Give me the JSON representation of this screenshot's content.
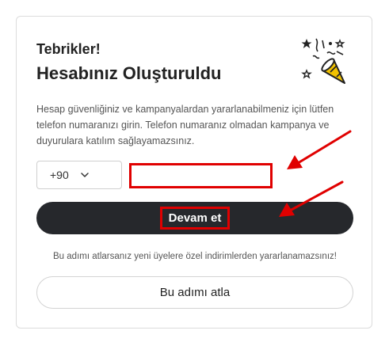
{
  "card": {
    "congrats": "Tebrikler!",
    "title": "Hesabınız Oluşturuldu",
    "description": "Hesap güvenliğiniz ve kampanyalardan yararlanabilmeniz için lütfen telefon numaranızı girin. Telefon numaranız olmadan kampanya ve duyurulara katılım sağlayamazsınız.",
    "country_code": "+90",
    "phone_value": "",
    "continue_label": "Devam et",
    "warning": "Bu adımı atlarsanız yeni üyelere özel indirimlerden yararlanamazsınız!",
    "skip_label": "Bu adımı atla"
  },
  "icons": {
    "celebration": "party-popper-icon",
    "dropdown": "chevron-down-icon",
    "annotation": "arrow-icon"
  },
  "colors": {
    "primary_button": "#26282c",
    "highlight": "#e00000",
    "border": "#dcdcdc"
  }
}
